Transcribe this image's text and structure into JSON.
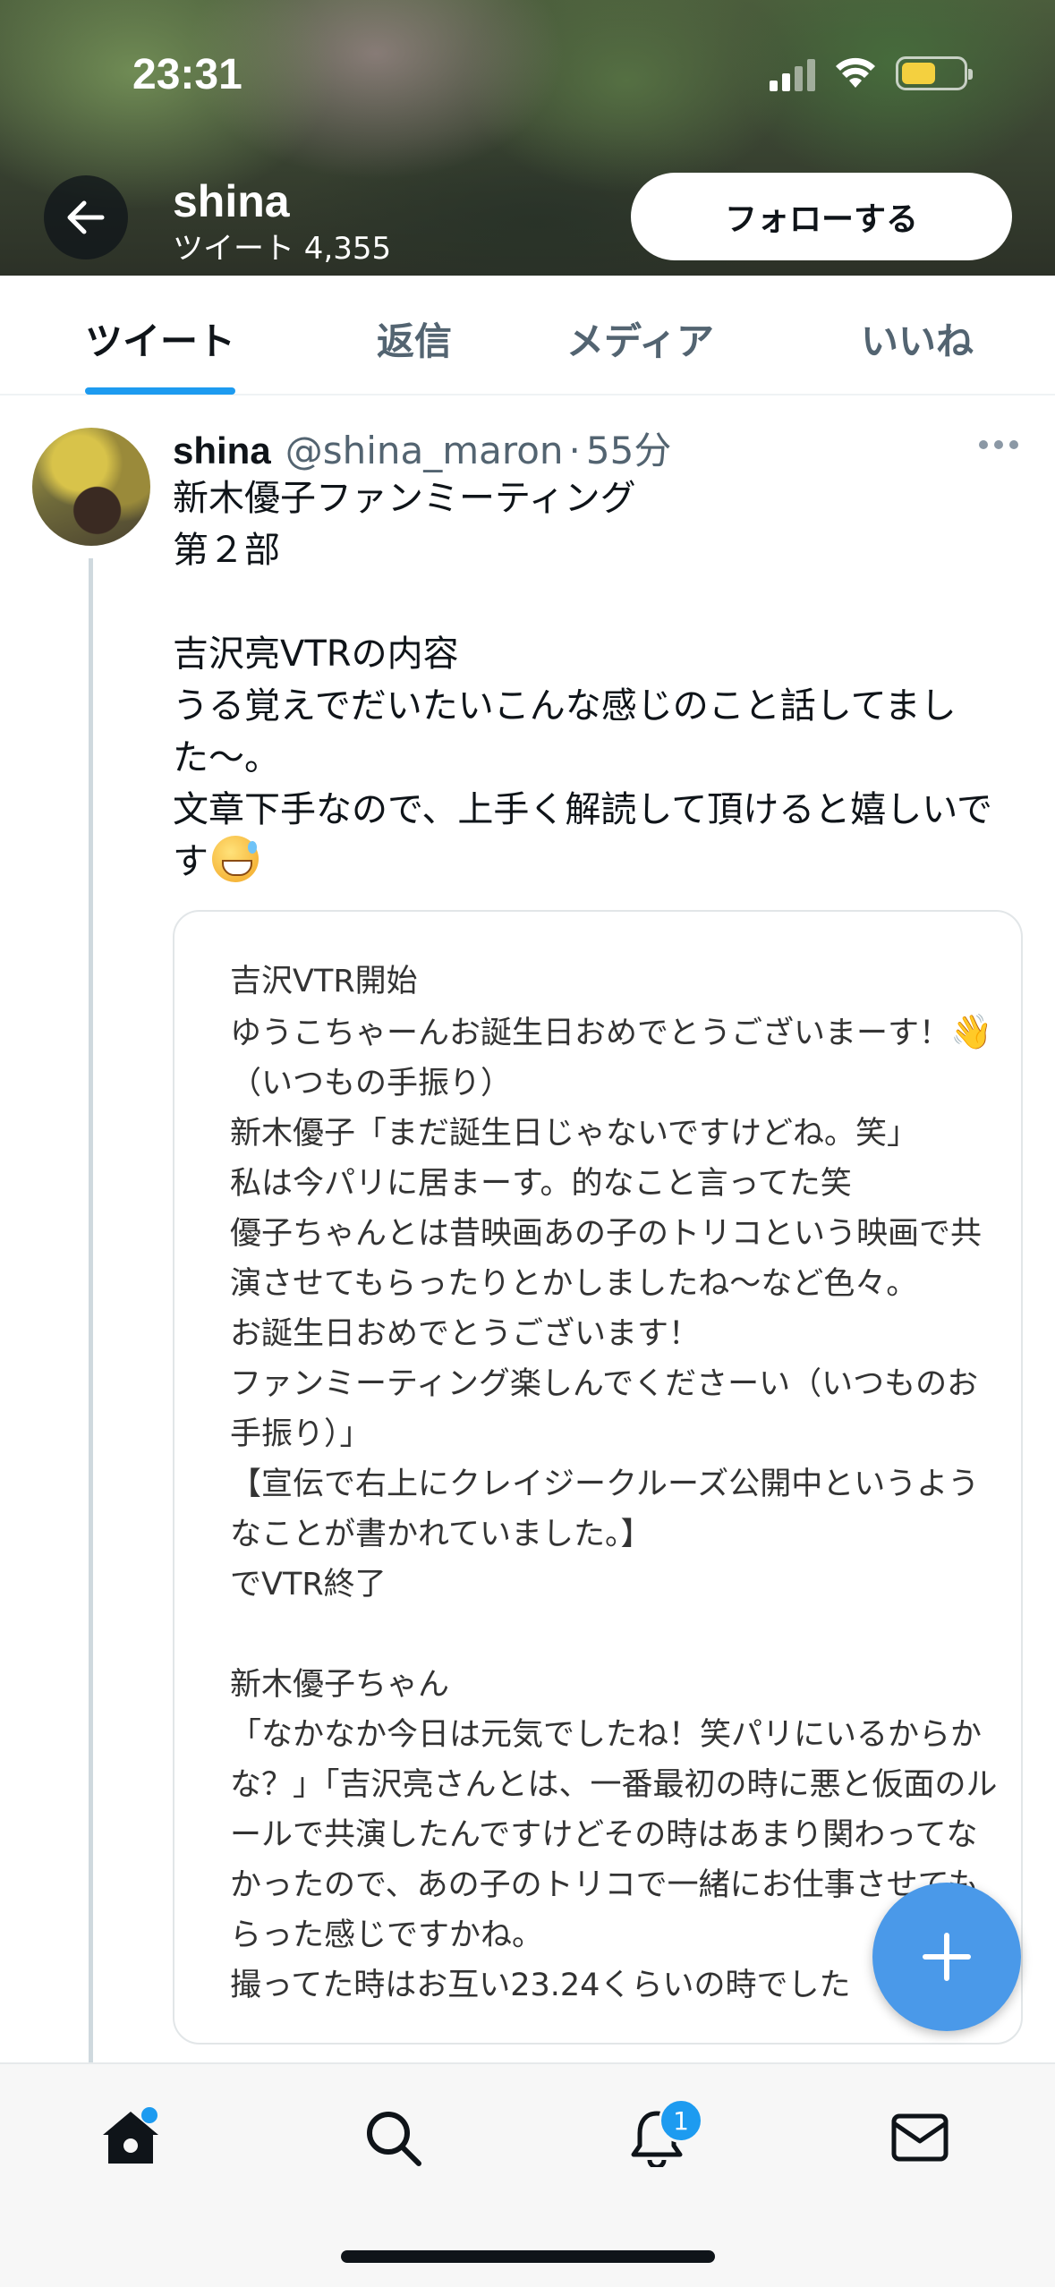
{
  "status_bar": {
    "time": "23:31",
    "battery_level": 0.55,
    "battery_color": "#f4d03f"
  },
  "header": {
    "profile_name": "shina",
    "tweet_count": "ツイート 4,355",
    "follow_label": "フォローする"
  },
  "tabs": [
    {
      "label": "ツイート",
      "active": true
    },
    {
      "label": "返信",
      "active": false
    },
    {
      "label": "メディア",
      "active": false
    },
    {
      "label": "いいね",
      "active": false
    }
  ],
  "tweet": {
    "name": "shina",
    "handle": "@shina_maron",
    "separator": "·",
    "time": "55分",
    "text_line1": "新木優子ファンミーティング",
    "text_line2": "第２部",
    "text_line3": "吉沢亮VTRの内容",
    "text_line4": "うる覚えでだいたいこんな感じのこと話してました〜。",
    "text_line5": "文章下手なので、上手く解読して頂けると嬉しいです",
    "text_emoji": "grinning-sweat-emoji"
  },
  "card": {
    "line01": "吉沢VTR開始",
    "line02": "ゆうこちゃーんお誕生日おめでとうございまーす！",
    "line02_emoji": "👋",
    "line02b": "（いつもの手振り）",
    "line03": "新木優子「まだ誕生日じゃないですけどね。笑」",
    "line04": "私は今パリに居まーす。的なこと言ってた笑",
    "line05": "優子ちゃんとは昔映画あの子のトリコという映画で共演させてもらったりとかしましたね〜など色々。",
    "line06": "お誕生日おめでとうございます！",
    "line07": "ファンミーティング楽しんでくださーい（いつものお手振り）」",
    "line08": "【宣伝で右上にクレイジークルーズ公開中というようなことが書かれていました。】",
    "line09": "でVTR終了",
    "line10": "新木優子ちゃん",
    "line11": "「なかなか今日は元気でしたね！笑パリにいるからかな？」「吉沢亮さんとは、一番最初の時に悪と仮面のルールで共演したんですけどその時はあまり関わってなかったので、あの子のトリコで一緒にお仕事させてもらった感じですかね。",
    "line12": "撮ってた時はお互い23.24くらいの時でした"
  },
  "bottom_nav": {
    "notification_count": "1",
    "accent_color": "#1d9bf0"
  }
}
